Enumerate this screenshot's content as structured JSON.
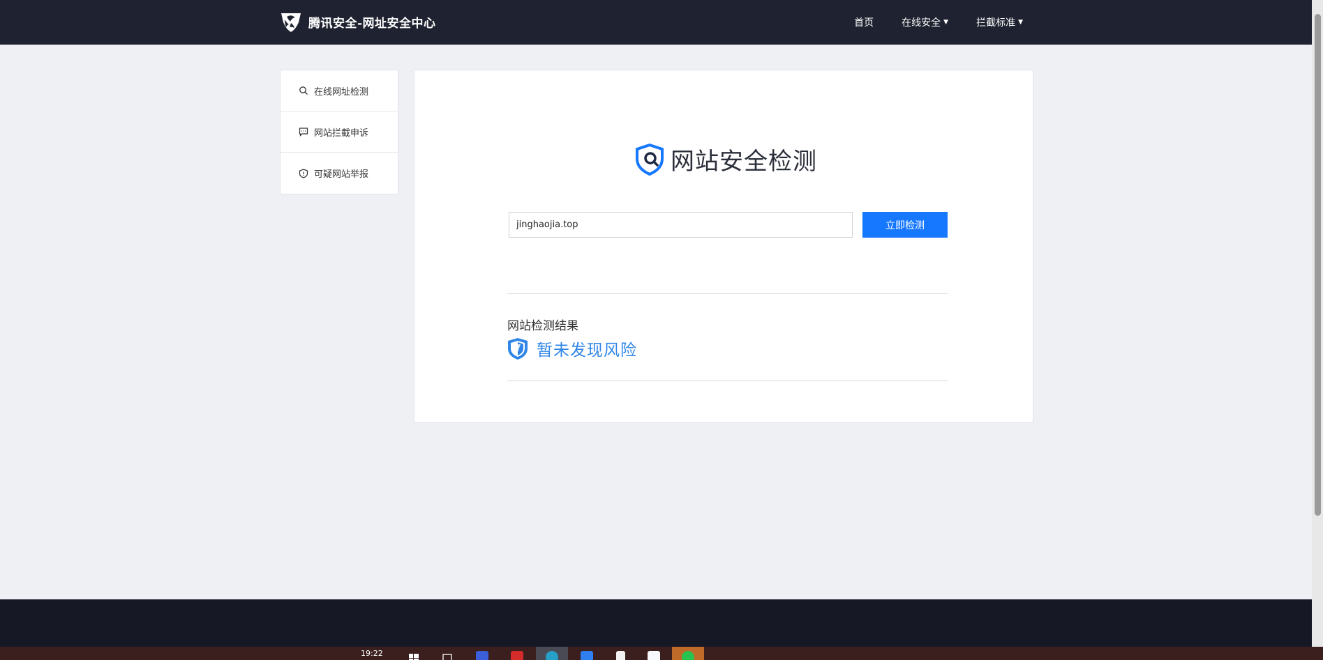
{
  "header": {
    "brand_title": "腾讯安全-网址安全中心",
    "nav": [
      {
        "label": "首页",
        "has_dropdown": false
      },
      {
        "label": "在线安全",
        "has_dropdown": true
      },
      {
        "label": "拦截标准",
        "has_dropdown": true
      }
    ]
  },
  "sidebar": {
    "items": [
      {
        "label": "在线网址检测",
        "icon": "search-icon"
      },
      {
        "label": "网站拦截申诉",
        "icon": "chat-icon"
      },
      {
        "label": "可疑网站举报",
        "icon": "shield-icon"
      }
    ]
  },
  "main": {
    "title": "网站安全检测",
    "search": {
      "value": "jinghaojia.top",
      "placeholder": ""
    },
    "check_button": "立即检测",
    "result_label": "网站检测结果",
    "result_status": "暂未发现风险"
  },
  "taskbar": {
    "clock": "19:22",
    "apps": [
      "windows-start-icon",
      "task-view-icon",
      "app-blue-icon",
      "app-red-icon",
      "edge-browser-icon",
      "app-arrow-icon",
      "file-icon",
      "app-board-icon",
      "wechat-icon"
    ]
  },
  "colors": {
    "header_bg": "#1f2230",
    "accent": "#1677ff",
    "result_blue": "#2f86e8",
    "page_bg": "#eff0f4",
    "footer_bg": "#171826"
  }
}
